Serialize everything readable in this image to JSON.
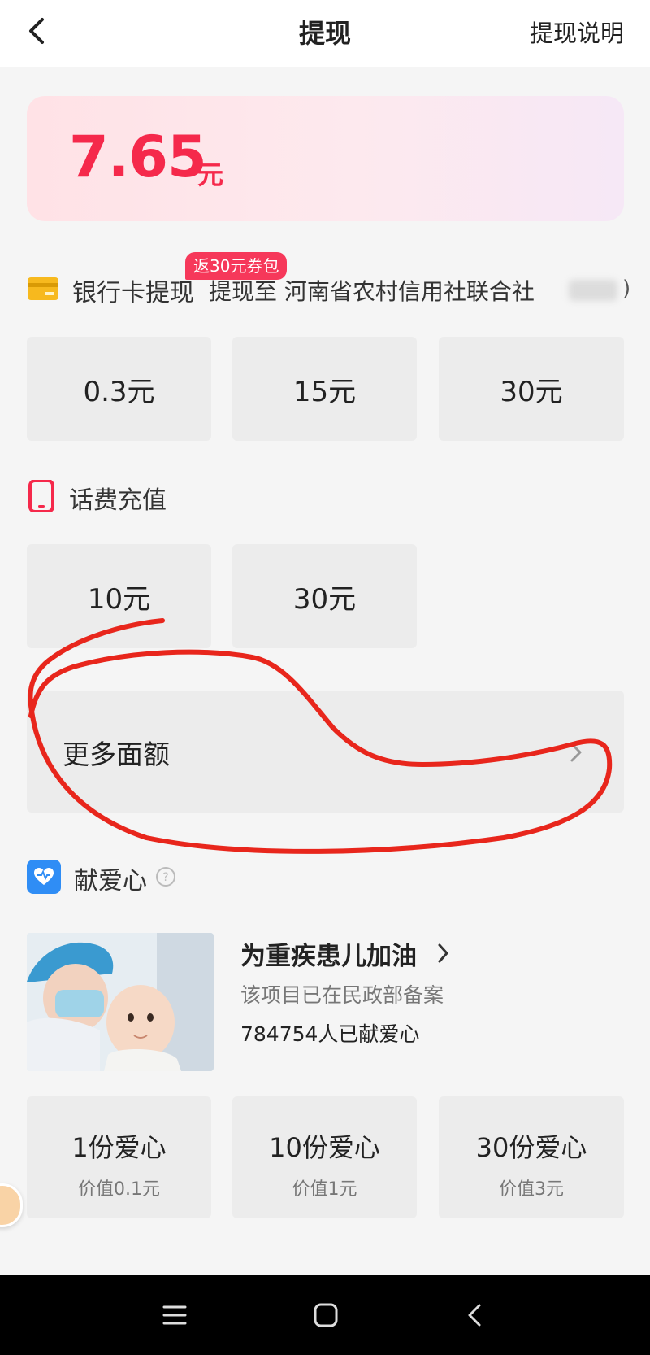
{
  "header": {
    "title": "提现",
    "help_link": "提现说明"
  },
  "balance": {
    "amount": "7.65",
    "unit": "元"
  },
  "bank_section": {
    "title": "银行卡提现",
    "badge": "返30元券包",
    "subtitle": "提现至 河南省农村信用社联合社",
    "suffix": ")",
    "options": [
      "0.3元",
      "15元",
      "30元"
    ]
  },
  "phone_section": {
    "title": "话费充值",
    "options": [
      "10元",
      "30元"
    ]
  },
  "more": {
    "label": "更多面额"
  },
  "charity_section": {
    "title": "献爱心",
    "project_title": "为重疾患儿加油",
    "project_note": "该项目已在民政部备案",
    "donor_count": "784754人已献爱心",
    "options": [
      {
        "title": "1份爱心",
        "value": "价值0.1元"
      },
      {
        "title": "10份爱心",
        "value": "价值1元"
      },
      {
        "title": "30份爱心",
        "value": "价值3元"
      }
    ]
  },
  "colors": {
    "accent": "#f5294b",
    "badge": "#f6385a",
    "annotation": "#e8261c",
    "bank_icon": "#f7b91e",
    "charity_icon": "#2f8df5"
  },
  "icons": [
    "back-arrow-icon",
    "bank-card-icon",
    "phone-icon",
    "chevron-right-icon",
    "charity-heart-icon",
    "help-circle-icon",
    "menu-icon",
    "home-icon",
    "back-icon"
  ]
}
